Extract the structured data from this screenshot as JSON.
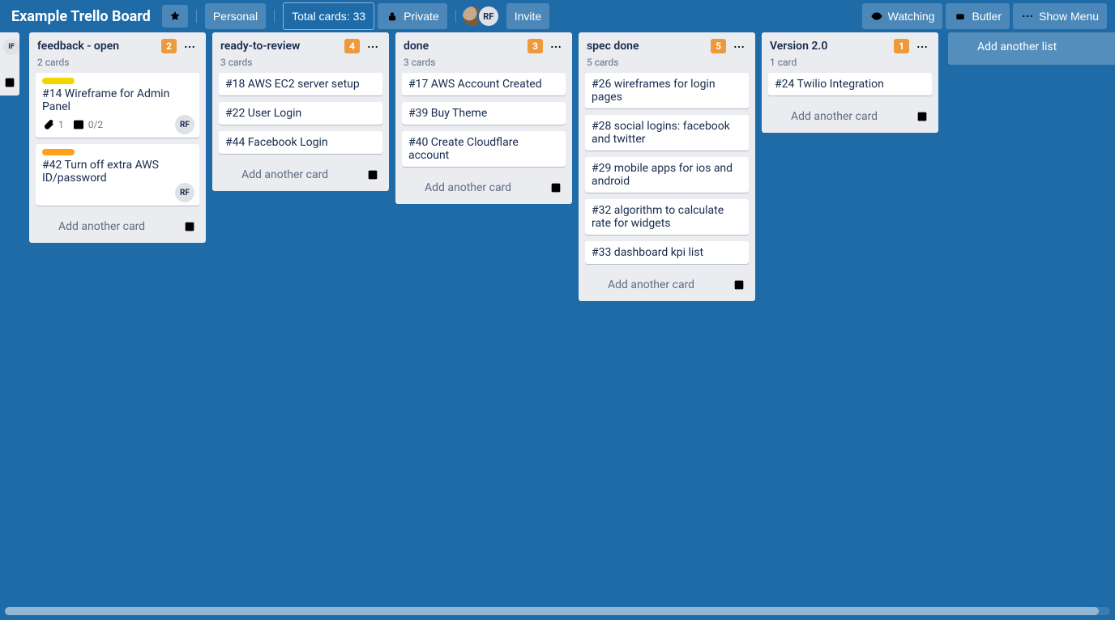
{
  "header": {
    "board_title": "Example Trello Board",
    "personal_label": "Personal",
    "total_cards_label": "Total cards: 33",
    "private_label": "Private",
    "invite_label": "Invite",
    "watching_label": "Watching",
    "butler_label": "Butler",
    "show_menu_label": "Show Menu",
    "member_initials": "RF"
  },
  "peek": {
    "member_initials": "IF"
  },
  "lists": [
    {
      "title": "feedback - open",
      "count_badge": "2",
      "subtitle": "2 cards",
      "cards": [
        {
          "title": "#14 Wireframe for Admin Panel",
          "labels": [
            "yellow"
          ],
          "attachments": "1",
          "checklist": "0/2",
          "member": "RF"
        },
        {
          "title": "#42 Turn off extra AWS ID/password",
          "labels": [
            "orange"
          ],
          "member": "RF"
        }
      ]
    },
    {
      "title": "ready-to-review",
      "count_badge": "4",
      "subtitle": "3 cards",
      "cards": [
        {
          "title": "#18 AWS EC2 server setup"
        },
        {
          "title": "#22 User Login"
        },
        {
          "title": "#44 Facebook Login"
        }
      ]
    },
    {
      "title": "done",
      "count_badge": "3",
      "subtitle": "3 cards",
      "cards": [
        {
          "title": "#17 AWS Account Created"
        },
        {
          "title": "#39 Buy Theme"
        },
        {
          "title": "#40 Create Cloudflare account"
        }
      ]
    },
    {
      "title": "spec done",
      "count_badge": "5",
      "subtitle": "5 cards",
      "cards": [
        {
          "title": "#26 wireframes for login pages"
        },
        {
          "title": "#28 social logins: facebook and twitter"
        },
        {
          "title": "#29 mobile apps for ios and android"
        },
        {
          "title": "#32 algorithm to calculate rate for widgets"
        },
        {
          "title": "#33 dashboard kpi list"
        }
      ]
    },
    {
      "title": "Version 2.0",
      "count_badge": "1",
      "subtitle": "1 card",
      "cards": [
        {
          "title": "#24 Twilio Integration"
        }
      ]
    }
  ],
  "labels": {
    "add_another_card": "Add another card",
    "add_another_list": "Add another list"
  }
}
